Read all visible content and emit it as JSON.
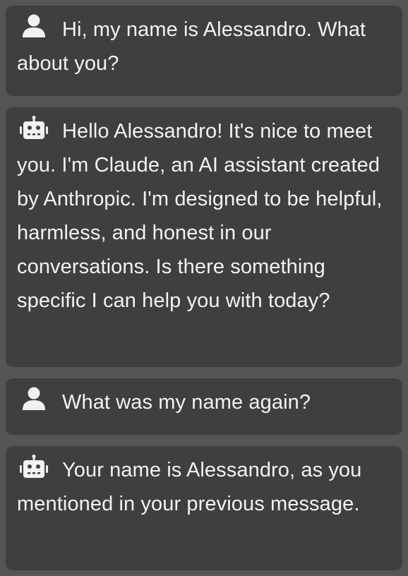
{
  "messages": [
    {
      "role": "user",
      "icon": "user-icon",
      "text": "Hi, my name is Alessandro. What about you?"
    },
    {
      "role": "assistant",
      "icon": "robot-icon",
      "text": "Hello Alessandro! It's nice to meet you. I'm Claude, an AI assistant created by Anthropic. I'm designed to be helpful, harmless, and honest in our conversations. Is there something specific I can help you with today?"
    },
    {
      "role": "user",
      "icon": "user-icon",
      "text": "What was my name again?"
    },
    {
      "role": "assistant",
      "icon": "robot-icon",
      "text": "Your name is Alessandro, as you mentioned in your previous message."
    }
  ],
  "colors": {
    "background": "#555555",
    "bubble": "#3f3f3f",
    "text": "#f2f2f2"
  }
}
